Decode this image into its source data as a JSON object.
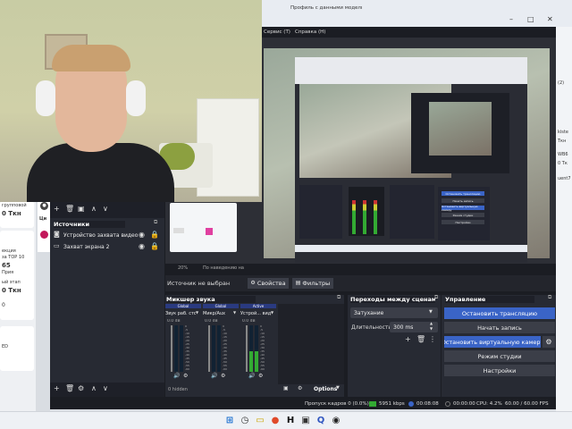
{
  "browser": {
    "tab_title": "Профиль с данными модели Fr",
    "left_sidebar": {
      "items": [
        {
          "label": "групповой",
          "sub": "0 Ткн"
        },
        {
          "label": "Ци"
        },
        {
          "label": "Ц"
        },
        {
          "label": "екция"
        },
        {
          "label": "за TOP 10"
        },
        {
          "label": "65"
        },
        {
          "label": "Прия"
        },
        {
          "label": "ый этап"
        },
        {
          "label": "0 Ткн"
        },
        {
          "label": "0"
        },
        {
          "label": "ED"
        }
      ]
    },
    "right_sidebar": {
      "items": [
        {
          "label": "(2)"
        },
        {
          "label": "kiste"
        },
        {
          "label": "Ткн"
        },
        {
          "label": "WB6"
        },
        {
          "label": "0 Тк"
        },
        {
          "label": "uent7"
        }
      ]
    }
  },
  "obs": {
    "menu": {
      "tools": "Сервис (Т)",
      "help": "Справка (Н)"
    },
    "preview": {
      "zoom": "20%",
      "toolbar_text": "По наведению на"
    },
    "no_source": "Источник не выбран",
    "properties_button": "Свойства",
    "filters_button": "Фильтры",
    "sources": {
      "title": "Источники",
      "items": [
        {
          "label": "Устройство захвата видео"
        },
        {
          "label": "Захват экрана 2"
        }
      ]
    },
    "mixer": {
      "title": "Микшер звука",
      "channels": [
        {
          "scope": "Global",
          "name": "Звук раб. стола",
          "db": "0.0 dB",
          "level": 0.0
        },
        {
          "scope": "Global",
          "name": "Микр/Aux",
          "db": "0.0 dB",
          "level": 0.0
        },
        {
          "scope": "Active",
          "name": "Устрой... видео",
          "db": "0.0 dB",
          "level": 0.45
        }
      ],
      "scale": [
        "0",
        "-5",
        "-10",
        "-15",
        "-20",
        "-25",
        "-30",
        "-35",
        "-40",
        "-45",
        "-50",
        "-55",
        "-60"
      ],
      "hidden": "0 hidden",
      "options": "Options"
    },
    "transitions": {
      "title": "Переходы между сценами",
      "selected": "Затухание",
      "duration_label": "Длительность",
      "duration_value": "300 ms"
    },
    "controls": {
      "title": "Управление",
      "stop_stream": "Остановить трансляцию",
      "start_record": "Начать запись",
      "stop_virtual_cam": "Остановить виртуальную камеру",
      "studio_mode": "Режим студии",
      "settings": "Настройки"
    },
    "status": {
      "dropped": "Пропуск кадров 0 (0.0%)",
      "bitrate": "5951 kbps",
      "stream_time": "00:08:08",
      "rec_time": "00:00:00",
      "cpu": "CPU: 4.2%",
      "fps": "60.00 / 60.00 FPS"
    },
    "nested_preview": {
      "studio_btns": [
        "Остановить трансляцию",
        "Начать запись",
        "Остановить виртуальную камеру",
        "Режим студии",
        "Настройки"
      ]
    }
  },
  "colors": {
    "obs_bg": "#272a33",
    "accent": "#3a64c7",
    "meter_green": "#3a3",
    "taskbar": "#eef1f5"
  },
  "taskbar": {
    "icons": [
      "windows-icon",
      "clock-icon",
      "folder-icon",
      "yandex-icon",
      "h-icon",
      "app-icon",
      "q-icon",
      "obs-icon"
    ]
  }
}
